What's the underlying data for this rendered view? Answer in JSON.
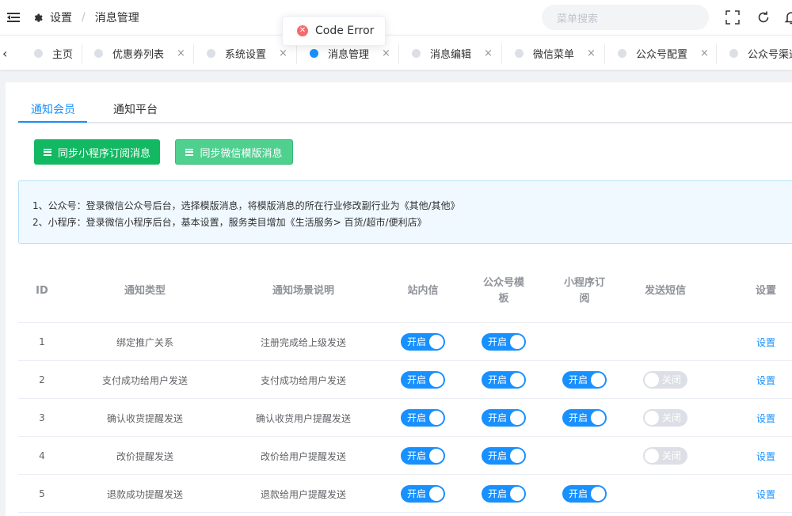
{
  "header": {
    "breadcrumb_home": "设置",
    "breadcrumb_current": "消息管理",
    "search_placeholder": "菜单搜索"
  },
  "toast": {
    "message": "Code Error"
  },
  "tags": [
    {
      "label": "主页"
    },
    {
      "label": "优惠券列表"
    },
    {
      "label": "系统设置"
    },
    {
      "label": "消息管理"
    },
    {
      "label": "消息编辑"
    },
    {
      "label": "微信菜单"
    },
    {
      "label": "公众号配置"
    },
    {
      "label": "公众号渠道"
    }
  ],
  "tabs": [
    "通知会员",
    "通知平台"
  ],
  "buttons": {
    "sync_mini": "同步小程序订阅消息",
    "sync_wechat": "同步微信模版消息"
  },
  "colors": {
    "sync_mini": "#13b862",
    "sync_wechat": "#4fd08f"
  },
  "alert": {
    "line1": "1、公众号：登录微信公众号后台，选择模版消息，将模版消息的所在行业修改副行业为《其他/其他》",
    "line2": "2、小程序：登录微信小程序后台，基本设置，服务类目增加《生活服务> 百货/超市/便利店》"
  },
  "table": {
    "headers": {
      "id": "ID",
      "type": "通知类型",
      "desc": "通知场景说明",
      "site": "站内信",
      "mp1": "公众号模",
      "mp2": "板",
      "mini1": "小程序订",
      "mini2": "阅",
      "sms": "发送短信",
      "setting": "设置"
    },
    "rows": [
      {
        "id": "1",
        "type": "绑定推广关系",
        "desc": "注册完成给上级发送",
        "site": "开启",
        "mp": "开启",
        "mini": "",
        "sms": "",
        "action": "设置"
      },
      {
        "id": "2",
        "type": "支付成功给用户发送",
        "desc": "支付成功给用户发送",
        "site": "开启",
        "mp": "开启",
        "mini": "开启",
        "sms": "关闭",
        "action": "设置"
      },
      {
        "id": "3",
        "type": "确认收货提醒发送",
        "desc": "确认收货用户提醒发送",
        "site": "开启",
        "mp": "开启",
        "mini": "开启",
        "sms": "关闭",
        "action": "设置"
      },
      {
        "id": "4",
        "type": "改价提醒发送",
        "desc": "改价给用户提醒发送",
        "site": "开启",
        "mp": "开启",
        "mini": "",
        "sms": "关闭",
        "action": "设置"
      },
      {
        "id": "5",
        "type": "退款成功提醒发送",
        "desc": "退款给用户提醒发送",
        "site": "开启",
        "mp": "开启",
        "mini": "开启",
        "sms": "",
        "action": "设置"
      }
    ]
  }
}
